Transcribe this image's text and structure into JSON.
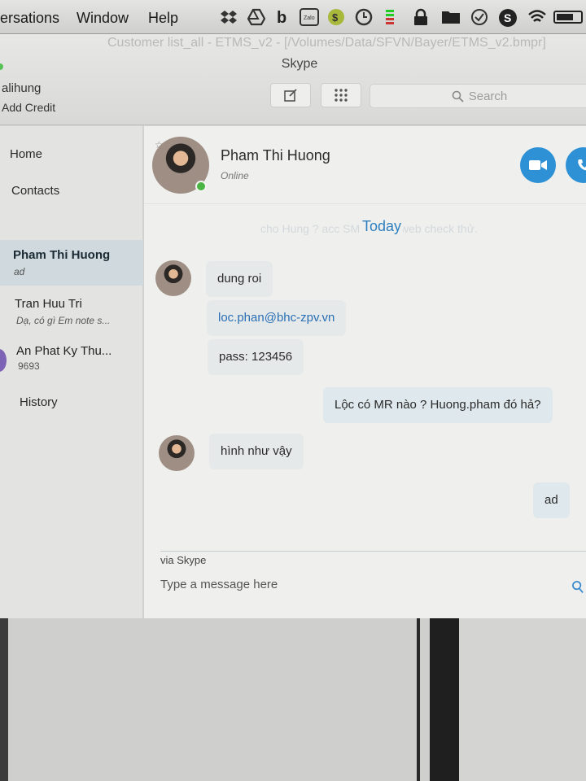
{
  "menubar": {
    "items": [
      "ersations",
      "Window",
      "Help"
    ],
    "tray_icons": [
      "dropbox-icon",
      "google-drive-icon",
      "b-icon",
      "zalo-icon",
      "evernote-icon",
      "clock-icon",
      "signal-bars-icon",
      "lock-icon",
      "folder-icon",
      "check-shield-icon",
      "skype-icon",
      "wifi-icon",
      "battery-icon"
    ]
  },
  "window": {
    "doc_title": "Customer list_all - ETMS_v2 - [/Volumes/Data/SFVN/Bayer/ETMS_v2.bmpr]",
    "title": "Skype",
    "user_name": "alihung",
    "add_credit": "Add Credit",
    "search_placeholder": "Search"
  },
  "sidebar": {
    "home": "Home",
    "contacts": "Contacts",
    "history": "History",
    "recents": [
      {
        "name": "Pham Thi Huong",
        "sub": "ad",
        "active": true
      },
      {
        "name": "Tran Huu Tri",
        "sub": "Dạ, có gì Em note s..."
      },
      {
        "name": "An Phat Ky Thu...",
        "sub": "9693"
      }
    ]
  },
  "conversation": {
    "contact_name": "Pham Thi Huong",
    "status": "Online",
    "ghost_text": "cho Hung ? acc         SM để vào web check thử.",
    "day_label": "Today",
    "messages": [
      {
        "text": "dung roi",
        "dir": "in"
      },
      {
        "text": "loc.phan@bhc-zpv.vn",
        "dir": "in"
      },
      {
        "text": "pass: 123456",
        "dir": "in"
      },
      {
        "text": "Lộc có MR nào ? Huong.pham đó hả?",
        "dir": "out"
      },
      {
        "text": "hình như vậy",
        "dir": "in"
      },
      {
        "text": "ad",
        "dir": "out"
      }
    ],
    "via": "via Skype",
    "input_placeholder": "Type a message here"
  },
  "colors": {
    "accent": "#2e91d6",
    "online": "#4bb543",
    "link": "#2a6fb5"
  }
}
